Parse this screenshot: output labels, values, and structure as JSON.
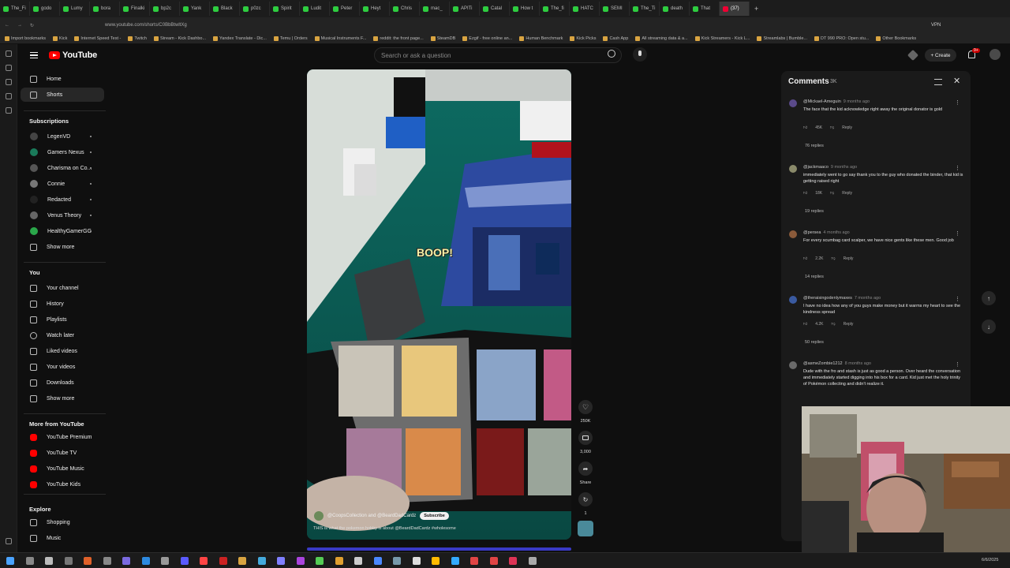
{
  "browser": {
    "tabs": [
      "The_Fi",
      "godo",
      "Lumy",
      "bora",
      "Finalki",
      "bp2c",
      "Yank",
      "Black",
      "p0zc",
      "Spirit",
      "Ludit",
      "Peter",
      "Heyt",
      "Chris",
      "mac_",
      "APITi",
      "Catal",
      "How t",
      "The_fi",
      "HATC",
      "SEMI",
      "The_Ti",
      "death",
      "That",
      "(37)"
    ],
    "url": "www.youtube.com/shorts/C0BbBtwltXg",
    "vpn_label": "VPN",
    "bookmarks": [
      "Import bookmarks",
      "Kick",
      "Internet Speed Test -",
      "Twitch",
      "Stream - Kick Dashbo...",
      "Yandex Translate - Dic...",
      "Temu | Orders",
      "Musical Instruments F...",
      "reddit: the front page...",
      "SteamDB",
      "Ezgif - free online an...",
      "Human Benchmark",
      "Kick Picks",
      "Cash App",
      "All streaming data & a...",
      "Kick Streamers - Kick L...",
      "Streamlabs | Bumble...",
      "DT 990 PRO: Open stu...",
      "Other Bookmarks"
    ]
  },
  "header": {
    "logo_text": "YouTube",
    "search_placeholder": "Search or ask a question",
    "create_label": "+ Create",
    "notif_count": "9+"
  },
  "nav": {
    "main": [
      {
        "label": "Home",
        "icon": "home-icon"
      },
      {
        "label": "Shorts",
        "icon": "shorts-icon",
        "active": true
      }
    ],
    "subscriptions_title": "Subscriptions",
    "subscriptions": [
      {
        "label": "LegenVD",
        "color": "#444"
      },
      {
        "label": "Gamers Nexus",
        "color": "#1a7a5a"
      },
      {
        "label": "Charisma on Co...",
        "color": "#555"
      },
      {
        "label": "Connie",
        "color": "#777"
      },
      {
        "label": "Redacted",
        "color": "#222"
      },
      {
        "label": "Venus Theory",
        "color": "#666"
      },
      {
        "label": "HealthyGamerGG",
        "color": "#2aa74a"
      }
    ],
    "show_more": "Show more",
    "you_title": "You",
    "you": [
      {
        "label": "Your channel"
      },
      {
        "label": "History"
      },
      {
        "label": "Playlists"
      },
      {
        "label": "Watch later"
      },
      {
        "label": "Liked videos"
      },
      {
        "label": "Your videos"
      },
      {
        "label": "Downloads"
      },
      {
        "label": "Show more"
      }
    ],
    "more_title": "More from YouTube",
    "more": [
      {
        "label": "YouTube Premium"
      },
      {
        "label": "YouTube TV"
      },
      {
        "label": "YouTube Music"
      },
      {
        "label": "YouTube Kids"
      }
    ],
    "explore_title": "Explore",
    "explore": [
      {
        "label": "Shopping"
      },
      {
        "label": "Music"
      }
    ]
  },
  "video": {
    "overlay_text": "BOOP!",
    "channel": "@CoopsCollection and @BeardDadCardz",
    "subscribe_label": "Subscribe",
    "caption": "THIS is what the pokemon hobby is about @BeardDadCardz #wholesome",
    "likes": "250K",
    "comment_count": "3,000",
    "share_label": "Share",
    "remix_count": "1"
  },
  "comments": {
    "title": "Comments",
    "count": "3K",
    "items": [
      {
        "author": "@Mickael-Ameguin",
        "time": "9 months ago",
        "text": "The face that the kid acknowledge right away the original donator is gold",
        "likes": "45K",
        "replies": "76 replies",
        "color": "#5a4a8a"
      },
      {
        "author": "@jackmaaco",
        "time": "9 months ago",
        "text": "immediately went to go say thank you to the guy who donated the binder, that kid is getting raised right",
        "likes": "18K",
        "replies": "19 replies",
        "color": "#8a8a6a"
      },
      {
        "author": "@persea",
        "time": "4 months ago",
        "text": "For every scumbag card scalper, we have nice gents like these men. Good job",
        "likes": "2.2K",
        "replies": "14 replies",
        "color": "#8a5a3a"
      },
      {
        "author": "@theraisingodenlymaxes",
        "time": "7 months ago",
        "text": "I have no idea how any of you guys make money but it warms my heart to see the kindness spread",
        "likes": "4.2K",
        "replies": "50 replies",
        "color": "#3a5aa0"
      },
      {
        "author": "@asmeZombie1212",
        "time": "8 months ago",
        "text": "Dude with the fro and stash is just as good a person. Over heard the conversation and immediately started digging into his box for a card. Kid just met the holy trinity of Pokémon collecting and didn't realize it.",
        "likes": "",
        "replies": "",
        "color": "#6a6a6a"
      }
    ],
    "reply_label": "Reply"
  },
  "system": {
    "clock": "6/6/2025"
  }
}
